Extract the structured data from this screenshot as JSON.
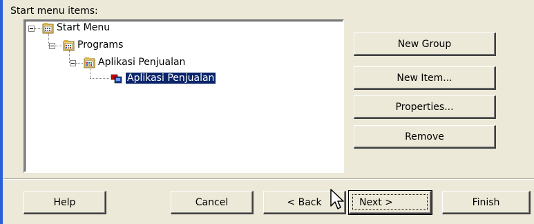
{
  "tree_label": "Start menu items:",
  "tree": {
    "start_menu": "Start Menu",
    "programs": "Programs",
    "app_folder": "Aplikasi Penjualan",
    "app_shortcut": "Aplikasi Penjualan"
  },
  "side_buttons": {
    "new_group": "New Group",
    "new_item": "New Item...",
    "properties": "Properties...",
    "remove": "Remove"
  },
  "footer_buttons": {
    "help": "Help",
    "cancel": "Cancel",
    "back": "< Back",
    "next": "Next >",
    "finish": "Finish"
  },
  "colors": {
    "accent": "#2b5fd9",
    "selection": "#0a246a",
    "face": "#ece9d8"
  }
}
